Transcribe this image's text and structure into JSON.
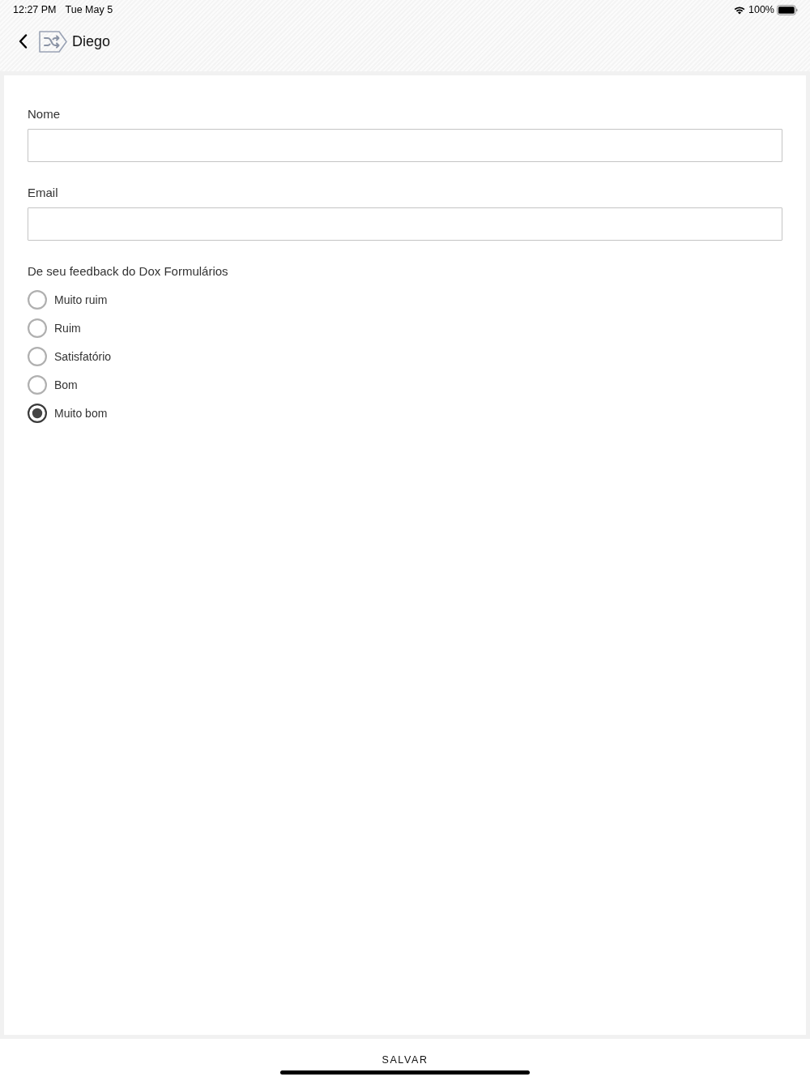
{
  "status_bar": {
    "time": "12:27 PM",
    "date": "Tue May 5",
    "battery_percent": "100%"
  },
  "header": {
    "title": "Diego"
  },
  "form": {
    "fields": [
      {
        "label": "Nome"
      },
      {
        "label": "Email"
      }
    ],
    "question": {
      "label": "De seu feedback do Dox Formulários",
      "options": [
        {
          "label": "Muito ruim",
          "selected": false
        },
        {
          "label": "Ruim",
          "selected": false
        },
        {
          "label": "Satisfatório",
          "selected": false
        },
        {
          "label": "Bom",
          "selected": false
        },
        {
          "label": "Muito bom",
          "selected": true
        }
      ]
    }
  },
  "footer": {
    "button": "SALVAR"
  }
}
